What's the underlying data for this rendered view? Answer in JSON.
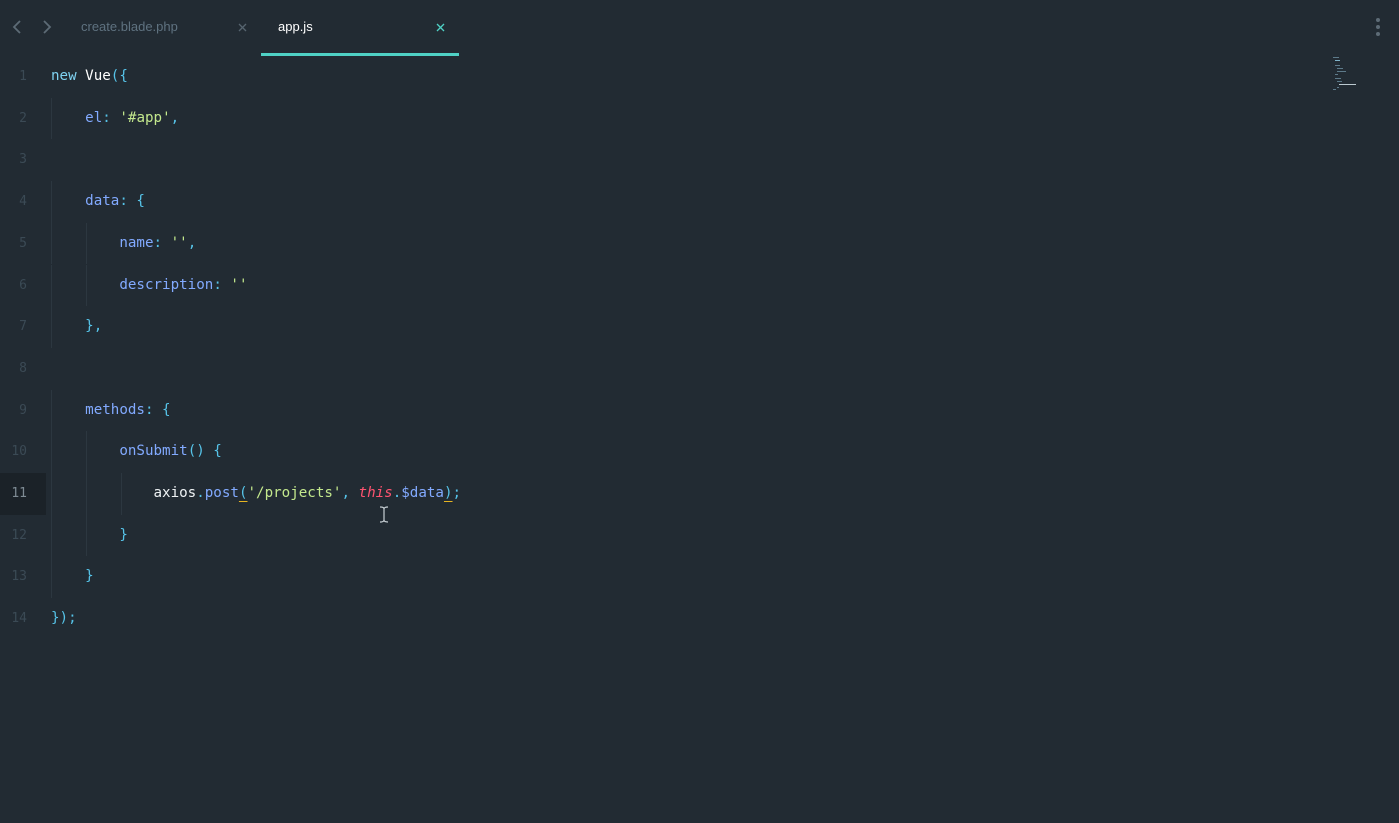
{
  "tabs": [
    {
      "label": "create.blade.php",
      "active": false
    },
    {
      "label": "app.js",
      "active": true
    }
  ],
  "colors": {
    "background": "#222b33",
    "accent": "#4fd1c5",
    "keyword": "#7fd3f2",
    "string": "#c3e88d",
    "property": "#82aaff",
    "this": "#ff5370",
    "bracket_match": "#e6b422"
  },
  "icons": {
    "back": "chevron-left-icon",
    "forward": "chevron-right-icon",
    "close": "close-icon",
    "more": "more-vertical-icon",
    "cursor": "text-cursor-icon"
  },
  "editor": {
    "current_line": 11,
    "lines": [
      {
        "num": "1",
        "tokens": [
          [
            "kw",
            "new"
          ],
          [
            "plain",
            " "
          ],
          [
            "class",
            "Vue"
          ],
          [
            "punc",
            "({"
          ]
        ]
      },
      {
        "num": "2",
        "tokens": [
          [
            "plain",
            "    "
          ],
          [
            "prop",
            "el"
          ],
          [
            "punc",
            ": "
          ],
          [
            "str",
            "'#app'"
          ],
          [
            "punc",
            ","
          ]
        ]
      },
      {
        "num": "3",
        "tokens": []
      },
      {
        "num": "4",
        "tokens": [
          [
            "plain",
            "    "
          ],
          [
            "prop",
            "data"
          ],
          [
            "punc",
            ": {"
          ]
        ]
      },
      {
        "num": "5",
        "tokens": [
          [
            "plain",
            "        "
          ],
          [
            "prop",
            "name"
          ],
          [
            "punc",
            ": "
          ],
          [
            "str",
            "''"
          ],
          [
            "punc",
            ","
          ]
        ]
      },
      {
        "num": "6",
        "tokens": [
          [
            "plain",
            "        "
          ],
          [
            "prop",
            "description"
          ],
          [
            "punc",
            ": "
          ],
          [
            "str",
            "''"
          ]
        ]
      },
      {
        "num": "7",
        "tokens": [
          [
            "plain",
            "    "
          ],
          [
            "punc",
            "},"
          ]
        ]
      },
      {
        "num": "8",
        "tokens": []
      },
      {
        "num": "9",
        "tokens": [
          [
            "plain",
            "    "
          ],
          [
            "prop",
            "methods"
          ],
          [
            "punc",
            ": {"
          ]
        ]
      },
      {
        "num": "10",
        "tokens": [
          [
            "plain",
            "        "
          ],
          [
            "func",
            "onSubmit"
          ],
          [
            "punc",
            "() {"
          ]
        ]
      },
      {
        "num": "11",
        "tokens": [
          [
            "plain",
            "            "
          ],
          [
            "ident",
            "axios"
          ],
          [
            "punc",
            "."
          ],
          [
            "func",
            "post"
          ],
          [
            "match",
            "("
          ],
          [
            "str",
            "'/projects'"
          ],
          [
            "punc",
            ", "
          ],
          [
            "this",
            "this"
          ],
          [
            "punc",
            "."
          ],
          [
            "var",
            "$data"
          ],
          [
            "match",
            ")"
          ],
          [
            "punc",
            ";"
          ]
        ]
      },
      {
        "num": "12",
        "tokens": [
          [
            "plain",
            "        "
          ],
          [
            "punc",
            "}"
          ]
        ]
      },
      {
        "num": "13",
        "tokens": [
          [
            "plain",
            "    "
          ],
          [
            "punc",
            "}"
          ]
        ]
      },
      {
        "num": "14",
        "tokens": [
          [
            "punc",
            "});"
          ]
        ]
      }
    ]
  }
}
